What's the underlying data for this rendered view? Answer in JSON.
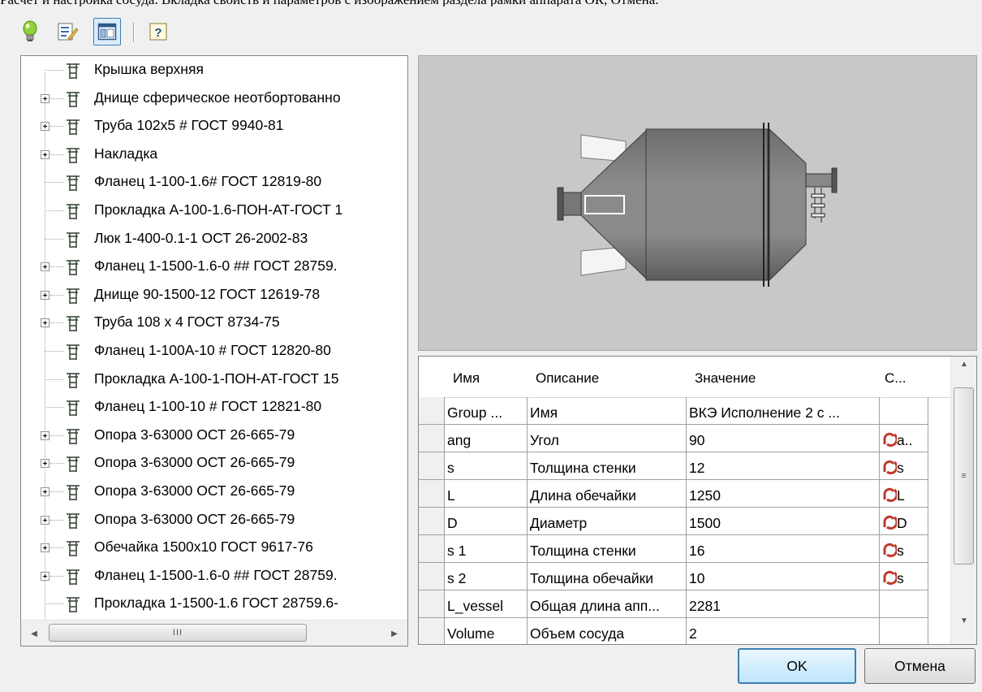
{
  "top_text": "Расчёт и настройка сосуда. Вкладка свойств и параметров с изображением раздела рамки аппарата ОК, Отмена.",
  "toolbar": {
    "icons": [
      "lightbulb-icon",
      "edit-list-icon",
      "layout-panel-icon",
      "help-icon"
    ]
  },
  "tree": {
    "items": [
      {
        "label": "Крышка верхняя",
        "expandable": false
      },
      {
        "label": "Днище сферическое неотбортованно",
        "expandable": true
      },
      {
        "label": "Труба 102х5 # ГОСТ 9940-81",
        "expandable": true
      },
      {
        "label": "Накладка",
        "expandable": true
      },
      {
        "label": "Фланец 1-100-1.6# ГОСТ 12819-80",
        "expandable": false
      },
      {
        "label": "Прокладка А-100-1.6-ПОН-АТ-ГОСТ 1",
        "expandable": false
      },
      {
        "label": "Люк 1-400-0.1-1 ОСТ 26-2002-83",
        "expandable": false
      },
      {
        "label": "Фланец 1-1500-1.6-0 ## ГОСТ 28759.",
        "expandable": true
      },
      {
        "label": "Днище 90-1500-12 ГОСТ 12619-78",
        "expandable": true
      },
      {
        "label": "Труба 108 х 4 ГОСТ 8734-75",
        "expandable": true
      },
      {
        "label": "Фланец 1-100А-10 # ГОСТ 12820-80",
        "expandable": false
      },
      {
        "label": "Прокладка А-100-1-ПОН-АТ-ГОСТ 15",
        "expandable": false
      },
      {
        "label": "Фланец 1-100-10 # ГОСТ 12821-80",
        "expandable": false
      },
      {
        "label": "Опора 3-63000 ОСТ 26-665-79",
        "expandable": true
      },
      {
        "label": "Опора 3-63000 ОСТ 26-665-79",
        "expandable": true
      },
      {
        "label": "Опора 3-63000 ОСТ 26-665-79",
        "expandable": true
      },
      {
        "label": "Опора 3-63000 ОСТ 26-665-79",
        "expandable": true
      },
      {
        "label": "Обечайка 1500х10 ГОСТ 9617-76",
        "expandable": true
      },
      {
        "label": "Фланец 1-1500-1.6-0 ## ГОСТ 28759.",
        "expandable": true
      },
      {
        "label": "Прокладка 1-1500-1.6 ГОСТ 28759.6-",
        "expandable": false
      }
    ],
    "scroll_thumb_glyph": "III"
  },
  "grid": {
    "columns": [
      "Имя",
      "Описание",
      "Значение",
      "С..."
    ],
    "rows": [
      {
        "name": "Group ...",
        "desc": "Имя",
        "value": "ВКЭ Исполнение 2 с ...",
        "ref": ""
      },
      {
        "name": "ang",
        "desc": "Угол",
        "value": "90",
        "ref": "a.."
      },
      {
        "name": "s",
        "desc": "Толщина стенки",
        "value": "12",
        "ref": "s"
      },
      {
        "name": "L",
        "desc": "Длина обечайки",
        "value": "1250",
        "ref": "L"
      },
      {
        "name": "D",
        "desc": "Диаметр",
        "value": "1500",
        "ref": "D"
      },
      {
        "name": "s 1",
        "desc": "Толщина стенки",
        "value": "16",
        "ref": "s"
      },
      {
        "name": "s 2",
        "desc": "Толщина обечайки",
        "value": "10",
        "ref": "s"
      },
      {
        "name": "L_vessel",
        "desc": "Общая длина апп...",
        "value": "2281",
        "ref": ""
      },
      {
        "name": "Volume",
        "desc": "Объем сосуда",
        "value": "2",
        "ref": ""
      }
    ],
    "scroll_thumb_glyph": "≡"
  },
  "buttons": {
    "ok": "OK",
    "cancel": "Отмена"
  },
  "colors": {
    "accent": "#3c7fb1",
    "preview_bg": "#c8c8c8",
    "link_icon": "#c0392b"
  }
}
